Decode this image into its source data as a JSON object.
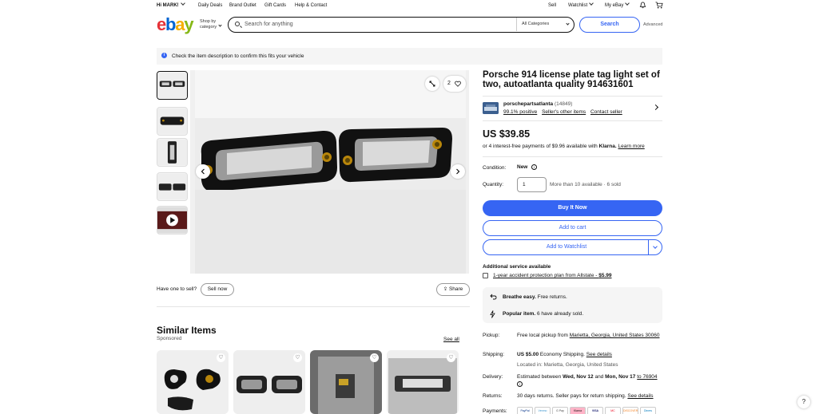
{
  "topbar": {
    "greeting": "Hi MARK!",
    "links": [
      "Daily Deals",
      "Brand Outlet",
      "Gift Cards",
      "Help & Contact"
    ],
    "sell": "Sell",
    "watchlist": "Watchlist",
    "my_ebay": "My eBay",
    "bell_icon": "bell-icon",
    "cart_icon": "cart-icon"
  },
  "header": {
    "logo": [
      "e",
      "b",
      "a",
      "y"
    ],
    "shop_by_1": "Shop by",
    "shop_by_2": "category",
    "search_placeholder": "Search for anything",
    "category": "All Categories",
    "search_button": "Search",
    "advanced": "Advanced"
  },
  "notice": {
    "text": "Check the item description to confirm this fits your vehicle"
  },
  "gallery": {
    "watch_count": "2",
    "have_one": "Have one to sell?",
    "sell_now": "Sell now",
    "share": "Share"
  },
  "similar": {
    "title": "Similar Items",
    "sponsored": "Sponsored",
    "see_all": "See all"
  },
  "item": {
    "title": "Porsche 914 license plate tag light set of two, autoatlanta quality 914631601",
    "seller_name": "porschepartsatlanta",
    "seller_feedback": "(14849)",
    "seller_positive": "99.1% positive",
    "seller_other": "Seller's other items",
    "contact_seller": "Contact seller",
    "price": "US $39.85",
    "klarna_pre": "or 4 interest-free payments of $9.96 available with",
    "klarna_brand": "Klarna.",
    "learn_more": "Learn more",
    "condition_label": "Condition:",
    "condition": "New",
    "quantity_label": "Quantity:",
    "quantity": "1",
    "availability": "More than 10 available · 6 sold",
    "buy_now": "Buy It Now",
    "add_to_cart": "Add to cart",
    "add_to_watchlist": "Add to Watchlist",
    "additional_service": "Additional service available",
    "protection_plan": "1-year accident protection plan from Allstate - ",
    "protection_price": "$5.99",
    "breathe": "Breathe easy.",
    "free_returns": "Free returns.",
    "popular": "Popular item.",
    "popular_rest": "6 have already sold.",
    "pickup_label": "Pickup:",
    "pickup_pre": "Free local pickup from ",
    "pickup_place": "Marietta, Georgia, United States 30060",
    "shipping_label": "Shipping:",
    "shipping_price": "US $5.00",
    "shipping_method": "Economy Shipping.",
    "see_details": "See details",
    "located": "Located in: Marietta, Georgia, United States",
    "delivery_label": "Delivery:",
    "delivery_pre": "Estimated between",
    "delivery_start": "Wed, Nov 12",
    "delivery_and": "and",
    "delivery_end": "Mon, Nov 17",
    "delivery_to": "to 76904",
    "returns_label": "Returns:",
    "returns": "30 days returns. Seller pays for return shipping.",
    "returns_details": "See details",
    "payments_label": "Payments:",
    "payment_methods": [
      "PayPal",
      "Venmo",
      "G Pay",
      "Klarna",
      "VISA",
      "MC",
      "DISCOVER",
      "Diners"
    ]
  },
  "help": "?"
}
